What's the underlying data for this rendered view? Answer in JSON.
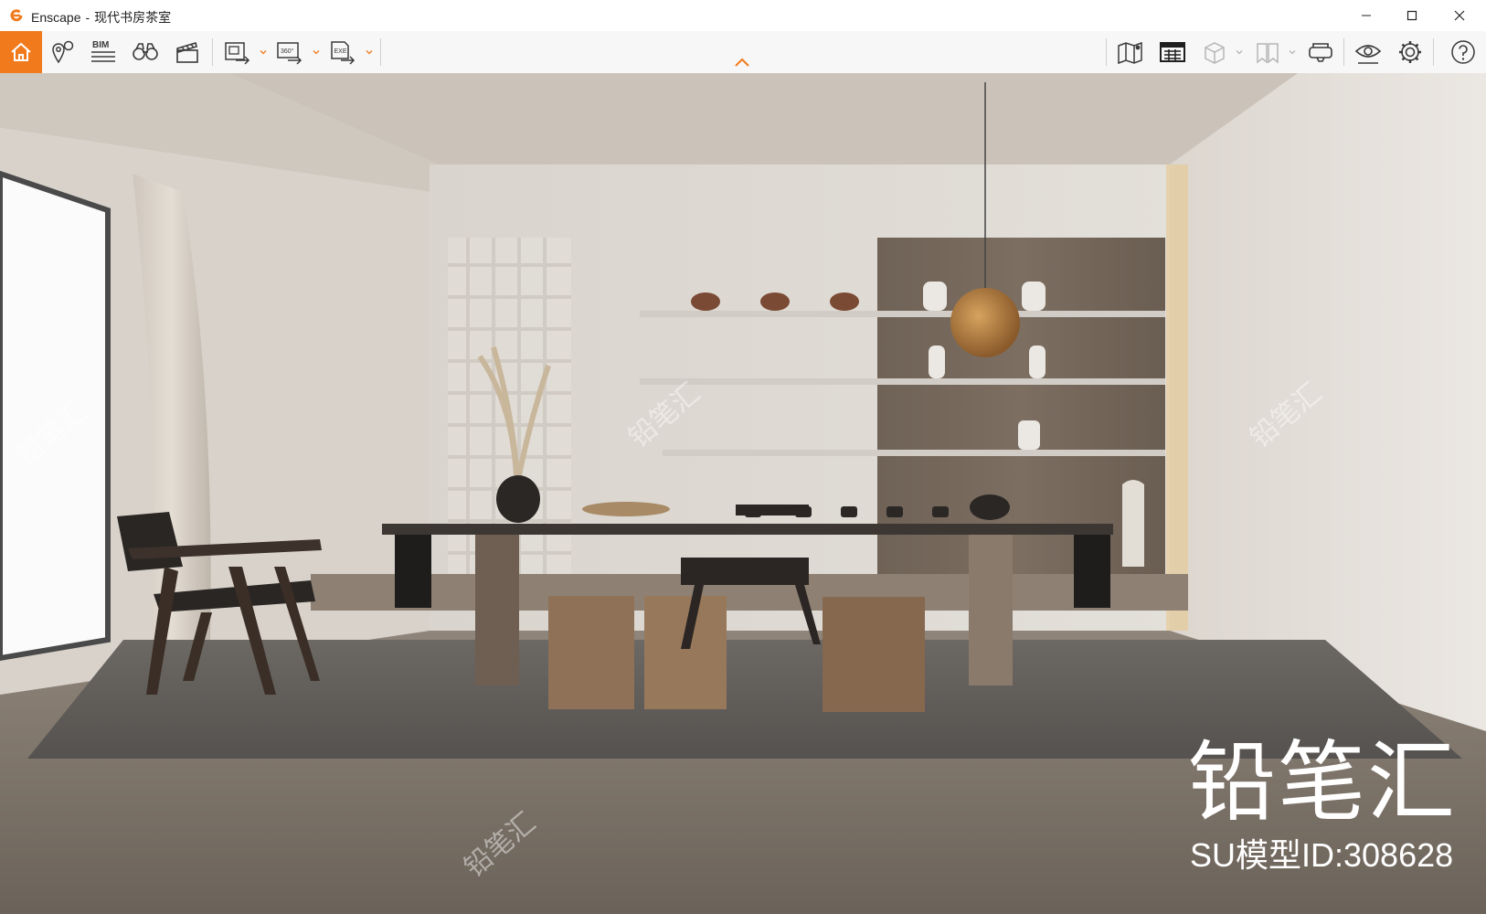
{
  "window": {
    "app_name": "Enscape",
    "separator": "-",
    "document_title": "现代书房茶室"
  },
  "toolbar": {
    "bim_label": "BIM",
    "panorama_badge": "360°",
    "exe_badge": "EXE"
  },
  "watermark": {
    "brand": "铅笔汇",
    "model_id": "SU模型ID:308628",
    "tile_text": "铅笔汇"
  },
  "colors": {
    "accent": "#f07a1c",
    "icon": "#3a3a3a",
    "icon_disabled": "#b5b5b5"
  },
  "icons": [
    "home-icon",
    "asset-library-icon",
    "bim-icon",
    "binoculars-icon",
    "clapperboard-icon",
    "screenshot-export-icon",
    "panorama-export-icon",
    "standalone-export-icon",
    "map-icon",
    "batch-render-icon",
    "cube-icon",
    "views-icon",
    "vr-headset-icon",
    "visual-settings-icon",
    "settings-icon",
    "help-icon"
  ]
}
